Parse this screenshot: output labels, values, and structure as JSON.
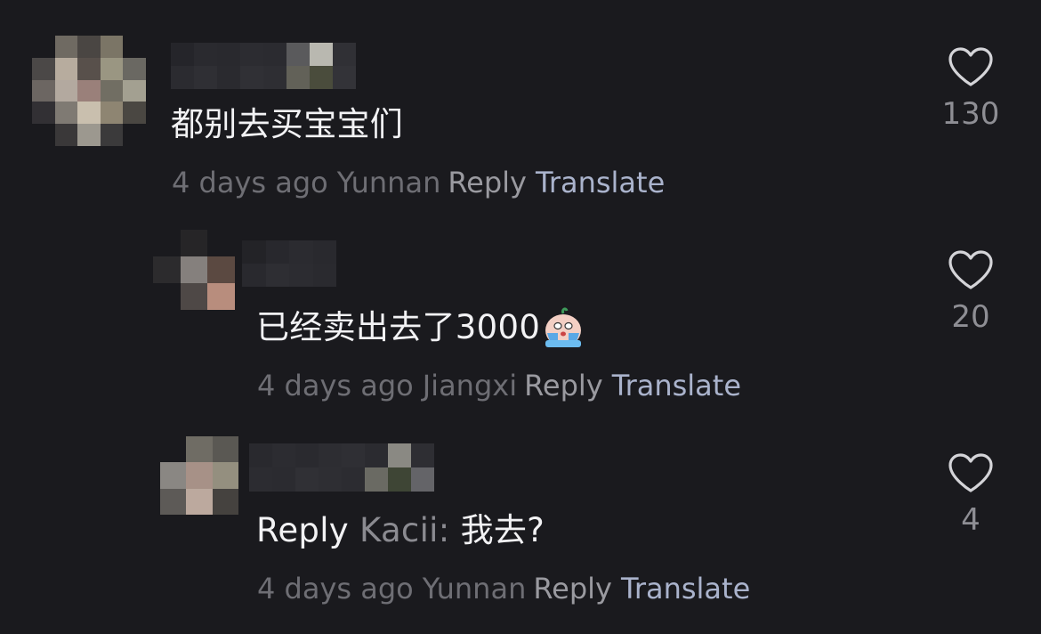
{
  "comments": [
    {
      "text": "都别去买宝宝们",
      "time": "4 days ago",
      "location": "Yunnan",
      "reply_label": "Reply",
      "translate_label": "Translate",
      "likes": "130"
    },
    {
      "text": "已经卖出去了3000",
      "emoji": "crying-face-emoji",
      "time": "4 days ago",
      "location": "Jiangxi",
      "reply_label": "Reply",
      "translate_label": "Translate",
      "likes": "20"
    },
    {
      "reply_prefix": "Reply",
      "mention": "Kacii:",
      "text": "我去?",
      "time": "4 days ago",
      "location": "Yunnan",
      "reply_label": "Reply",
      "translate_label": "Translate",
      "likes": "4"
    }
  ],
  "icons": {
    "like": "heart-outline-icon"
  },
  "colors": {
    "background": "#1a1a1e",
    "primary_text": "#f2f2f4",
    "secondary_text": "#6e6e74",
    "translate_link": "#aab3cc"
  }
}
